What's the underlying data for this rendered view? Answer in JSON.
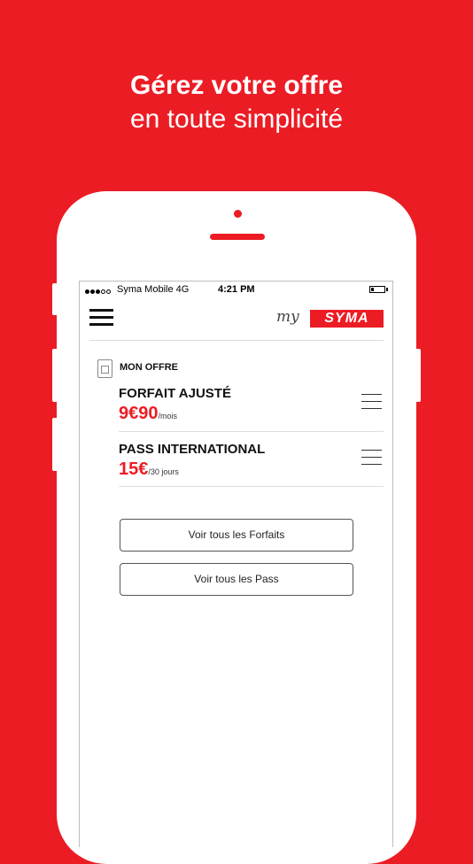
{
  "headline": {
    "line1": "Gérez votre offre",
    "line2": "en toute simplicité"
  },
  "status_bar": {
    "carrier": "Syma Mobile 4G",
    "time": "4:21 PM"
  },
  "header": {
    "logo_my": "my",
    "logo_brand": "SYMA"
  },
  "section": {
    "title": "MON OFFRE"
  },
  "offers": [
    {
      "name": "FORFAIT AJUSTÉ",
      "price": "9€90",
      "unit": "/mois"
    },
    {
      "name": "PASS INTERNATIONAL",
      "price": "15€",
      "unit": "/30 jours"
    }
  ],
  "buttons": {
    "forfaits": "Voir tous les Forfaits",
    "pass": "Voir tous les Pass"
  },
  "colors": {
    "brand_red": "#ec1c24",
    "white": "#ffffff"
  },
  "icons": {
    "menu": "hamburger-icon",
    "sim": "sim-card-icon",
    "offer_menu": "list-icon"
  }
}
